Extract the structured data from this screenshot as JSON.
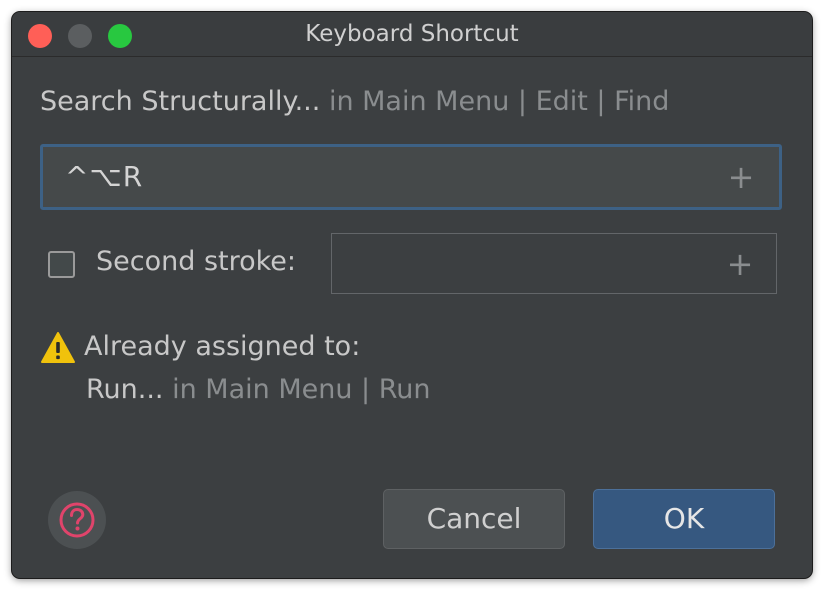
{
  "window": {
    "title": "Keyboard Shortcut"
  },
  "action": {
    "name": "Search Structurally...",
    "path": " in Main Menu | Edit | Find"
  },
  "shortcut": {
    "first_stroke": "^⌥R",
    "add_symbol": "+"
  },
  "second_stroke": {
    "label": "Second stroke:",
    "checked": false,
    "value": "",
    "add_symbol": "+"
  },
  "conflict": {
    "heading": "Already assigned to:",
    "action_name": "Run...",
    "action_path": " in Main Menu | Run"
  },
  "buttons": {
    "cancel_label": "Cancel",
    "ok_label": "OK"
  },
  "colors": {
    "background": "#3c3f41",
    "focus_border": "#3d6185",
    "ok_button": "#365880",
    "warning": "#f0c20c",
    "help_icon": "#e0446b"
  },
  "icons": {
    "warning": "warning-icon",
    "help": "help-icon",
    "plus": "plus-icon"
  }
}
